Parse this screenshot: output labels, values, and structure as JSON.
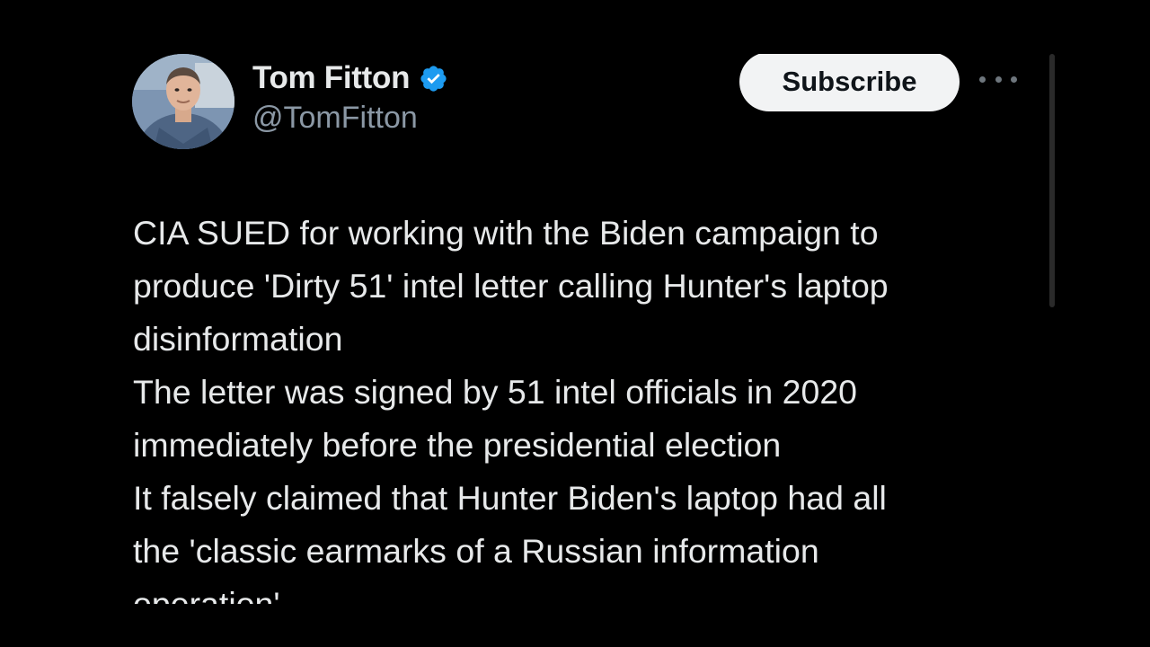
{
  "author": {
    "display_name": "Tom Fitton",
    "handle": "@TomFitton",
    "verified_icon": "verified-badge-icon",
    "verified_color": "#1d9bf0"
  },
  "actions": {
    "subscribe_label": "Subscribe",
    "more_icon": "more-options-icon"
  },
  "tweet": {
    "lines": [
      "CIA SUED for working with the Biden campaign to",
      "produce 'Dirty 51' intel letter calling Hunter's laptop",
      "disinformation",
      "The letter was signed by 51 intel officials in 2020",
      "immediately before the presidential election",
      "It falsely claimed that Hunter Biden's laptop had all",
      "the 'classic earmarks of a Russian information",
      "operation'"
    ]
  },
  "colors": {
    "background": "#000000",
    "text_primary": "#e7e9ea",
    "text_secondary": "#8b98a5",
    "button_bg": "#f2f3f4",
    "button_text": "#0f1419"
  }
}
